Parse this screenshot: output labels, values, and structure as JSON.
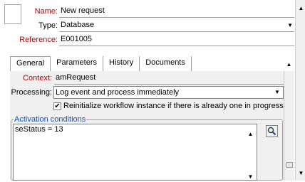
{
  "header": {
    "name_label": "Name:",
    "name_value": "New request",
    "type_label": "Type:",
    "type_value": "Database",
    "reference_label": "Reference:",
    "reference_value": "E001005"
  },
  "tabs": [
    {
      "label": "General"
    },
    {
      "label": "Parameters"
    },
    {
      "label": "History"
    },
    {
      "label": "Documents"
    }
  ],
  "general": {
    "context_label": "Context:",
    "context_value": "amRequest",
    "processing_label": "Processing:",
    "processing_value": "Log event and process immediately",
    "reinit_checked": true,
    "reinit_label": "Reinitialize workflow instance if there is already one in progress",
    "activation_title": "Activation conditions",
    "activation_text": "seStatus = 13"
  },
  "icons": {
    "check": "✔",
    "up": "▲",
    "down": "▼",
    "search": "magnifier-icon"
  }
}
